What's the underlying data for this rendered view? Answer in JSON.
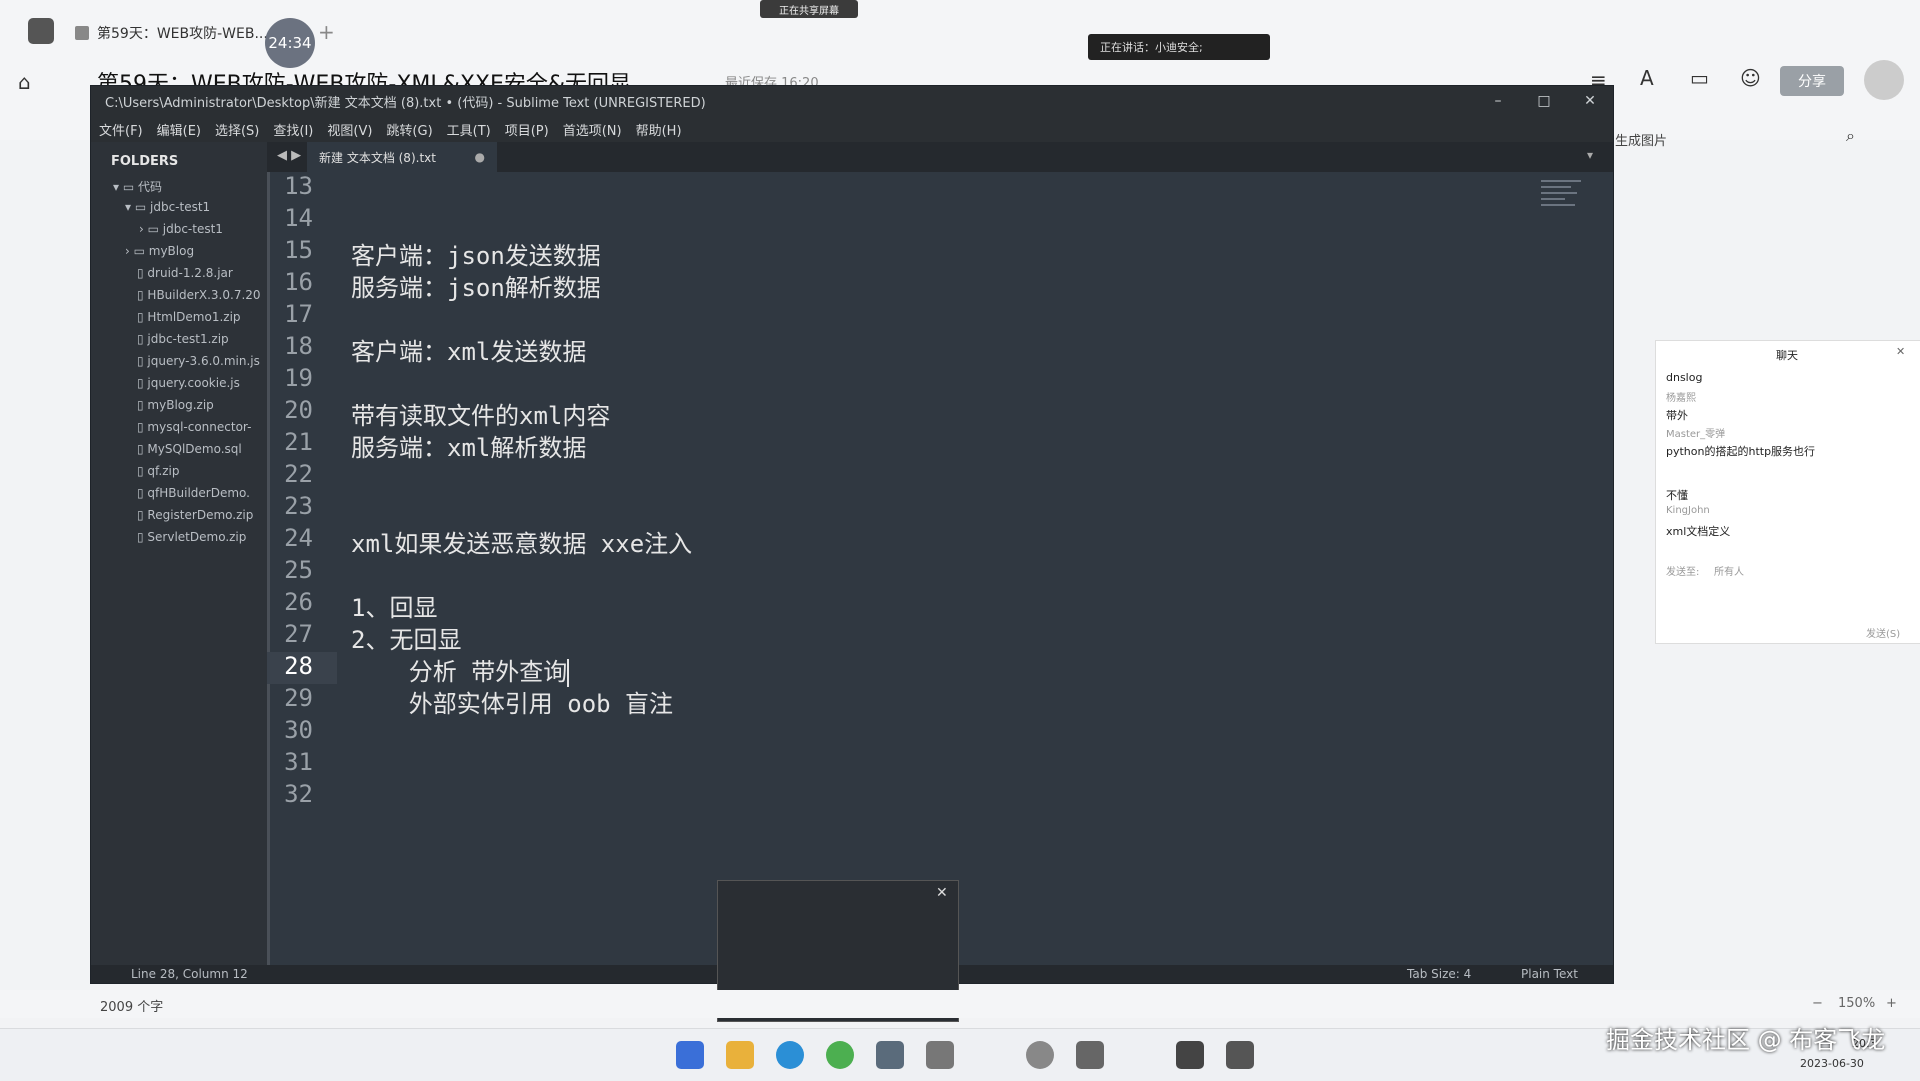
{
  "host": {
    "tab_label": "第59天：WEB攻防-WEB...",
    "timer": "24:34",
    "add_tab": "+",
    "doc_title": "第59天：WEB攻防-WEB攻防-XML&XXE安全&无回显",
    "saved_text": "最近保存 16:20",
    "share_pill": "正在共享屏幕",
    "speaking_text": "正在讲话：小迪安全;",
    "share_button": "分享",
    "gen_image": "生成图片",
    "word_count": "2009 个字",
    "zoom": "150%",
    "zoom_minus": "−",
    "zoom_plus": "+"
  },
  "sublime": {
    "title": "C:\\Users\\Administrator\\Desktop\\新建 文本文档 (8).txt • (代码) - Sublime Text (UNREGISTERED)",
    "menu": [
      "文件(F)",
      "编辑(E)",
      "选择(S)",
      "查找(I)",
      "视图(V)",
      "跳转(G)",
      "工具(T)",
      "项目(P)",
      "首选项(N)",
      "帮助(H)"
    ],
    "folders_header": "FOLDERS",
    "tree": [
      "代码",
      "jdbc-test1",
      "jdbc-test1",
      "myBlog",
      "druid-1.2.8.jar",
      "HBuilderX.3.0.7.20",
      "HtmlDemo1.zip",
      "jdbc-test1.zip",
      "jquery-3.6.0.min.js",
      "jquery.cookie.js",
      "myBlog.zip",
      "mysql-connector-",
      "MySQlDemo.sql",
      "qf.zip",
      "qfHBuilderDemo.",
      "RegisterDemo.zip",
      "ServletDemo.zip"
    ],
    "tab_label": "新建 文本文档 (8).txt",
    "lines": [
      {
        "n": "13",
        "t": ""
      },
      {
        "n": "14",
        "t": ""
      },
      {
        "n": "15",
        "t": "客户端：json发送数据"
      },
      {
        "n": "16",
        "t": "服务端：json解析数据"
      },
      {
        "n": "17",
        "t": ""
      },
      {
        "n": "18",
        "t": "客户端：xml发送数据"
      },
      {
        "n": "19",
        "t": ""
      },
      {
        "n": "20",
        "t": "带有读取文件的xml内容"
      },
      {
        "n": "21",
        "t": "服务端：xml解析数据"
      },
      {
        "n": "22",
        "t": ""
      },
      {
        "n": "23",
        "t": ""
      },
      {
        "n": "24",
        "t": "xml如果发送恶意数据 xxe注入"
      },
      {
        "n": "25",
        "t": ""
      },
      {
        "n": "26",
        "t": "1、回显"
      },
      {
        "n": "27",
        "t": "2、无回显"
      },
      {
        "n": "28",
        "t": "    分析 带外查询"
      },
      {
        "n": "29",
        "t": "    外部实体引用 oob 盲注"
      },
      {
        "n": "30",
        "t": ""
      },
      {
        "n": "31",
        "t": ""
      },
      {
        "n": "32",
        "t": ""
      }
    ],
    "status_left": "Line 28, Column 12",
    "tab_size": "Tab Size: 4",
    "syntax": "Plain Text"
  },
  "chat": {
    "title": "聊天",
    "messages": [
      {
        "text": "dnslog",
        "user": "杨嘉熙"
      },
      {
        "text": "带外",
        "user": "Master_零弹"
      },
      {
        "text": "python的搭起的http服务也行",
        "user": ""
      },
      {
        "text": "不懂",
        "user": "KingJohn"
      },
      {
        "text": "xml文档定义",
        "user": ""
      }
    ],
    "send_to_label": "发送至:",
    "send_to_value": "所有人",
    "send_button": "发送(S)"
  },
  "taskbar": {
    "date": "2023-06-30",
    "time": "20:3"
  },
  "watermark": "掘金技术社区 @ 布客飞龙",
  "colors": {
    "editor_bg": "#303841",
    "sidebar_bg": "#2d3238",
    "text": "#e6e6e6",
    "line_number": "#9aa1a8"
  }
}
